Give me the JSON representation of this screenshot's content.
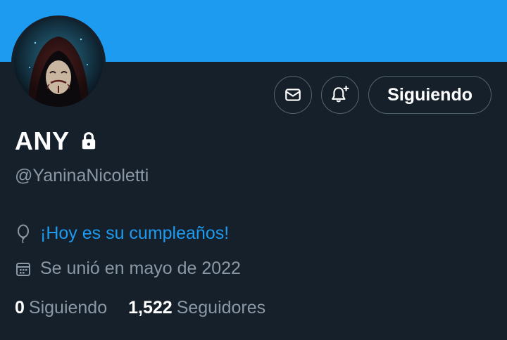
{
  "profile": {
    "display_name": "ANY",
    "handle": "@YaninaNicoletti",
    "birthday_text": "¡Hoy es su cumpleaños!",
    "joined_text": "Se unió en mayo de 2022"
  },
  "actions": {
    "follow_label": "Siguiendo"
  },
  "stats": {
    "following_count": "0",
    "following_label": "Siguiendo",
    "followers_count": "1,522",
    "followers_label": "Seguidores"
  },
  "icons": {
    "lock": "lock-icon",
    "message": "envelope-icon",
    "notifications": "bell-plus-icon",
    "birthday": "balloon-icon",
    "joined": "calendar-icon"
  },
  "colors": {
    "banner": "#1d9bf0",
    "background": "#15202b",
    "accent": "#1d9bf0",
    "secondary_text": "#8b98a5"
  }
}
